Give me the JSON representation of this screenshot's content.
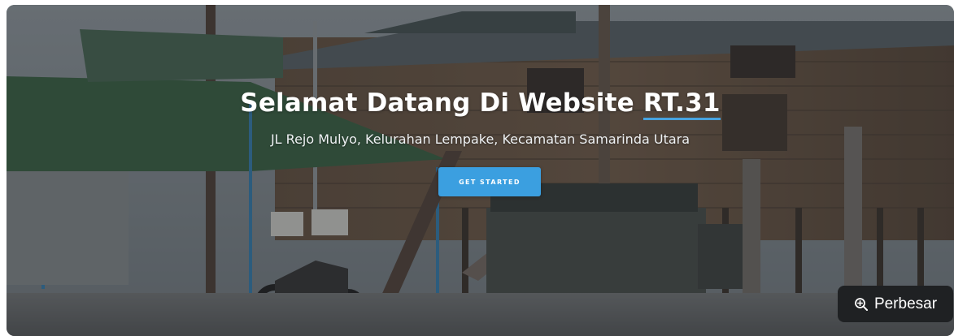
{
  "hero": {
    "title_main": "Selamat Datang Di Website ",
    "title_accent": "RT.31",
    "subtitle": "JL Rejo Mulyo, Kelurahan Lempake, Kecamatan Samarinda Utara",
    "cta_label": "GET STARTED"
  },
  "viewer": {
    "zoom_label": "Perbesar",
    "zoom_icon": "zoom-in-icon"
  },
  "colors": {
    "accent": "#3b9fe0",
    "overlay": "#14181c",
    "zoom_bg": "#1f2123"
  }
}
